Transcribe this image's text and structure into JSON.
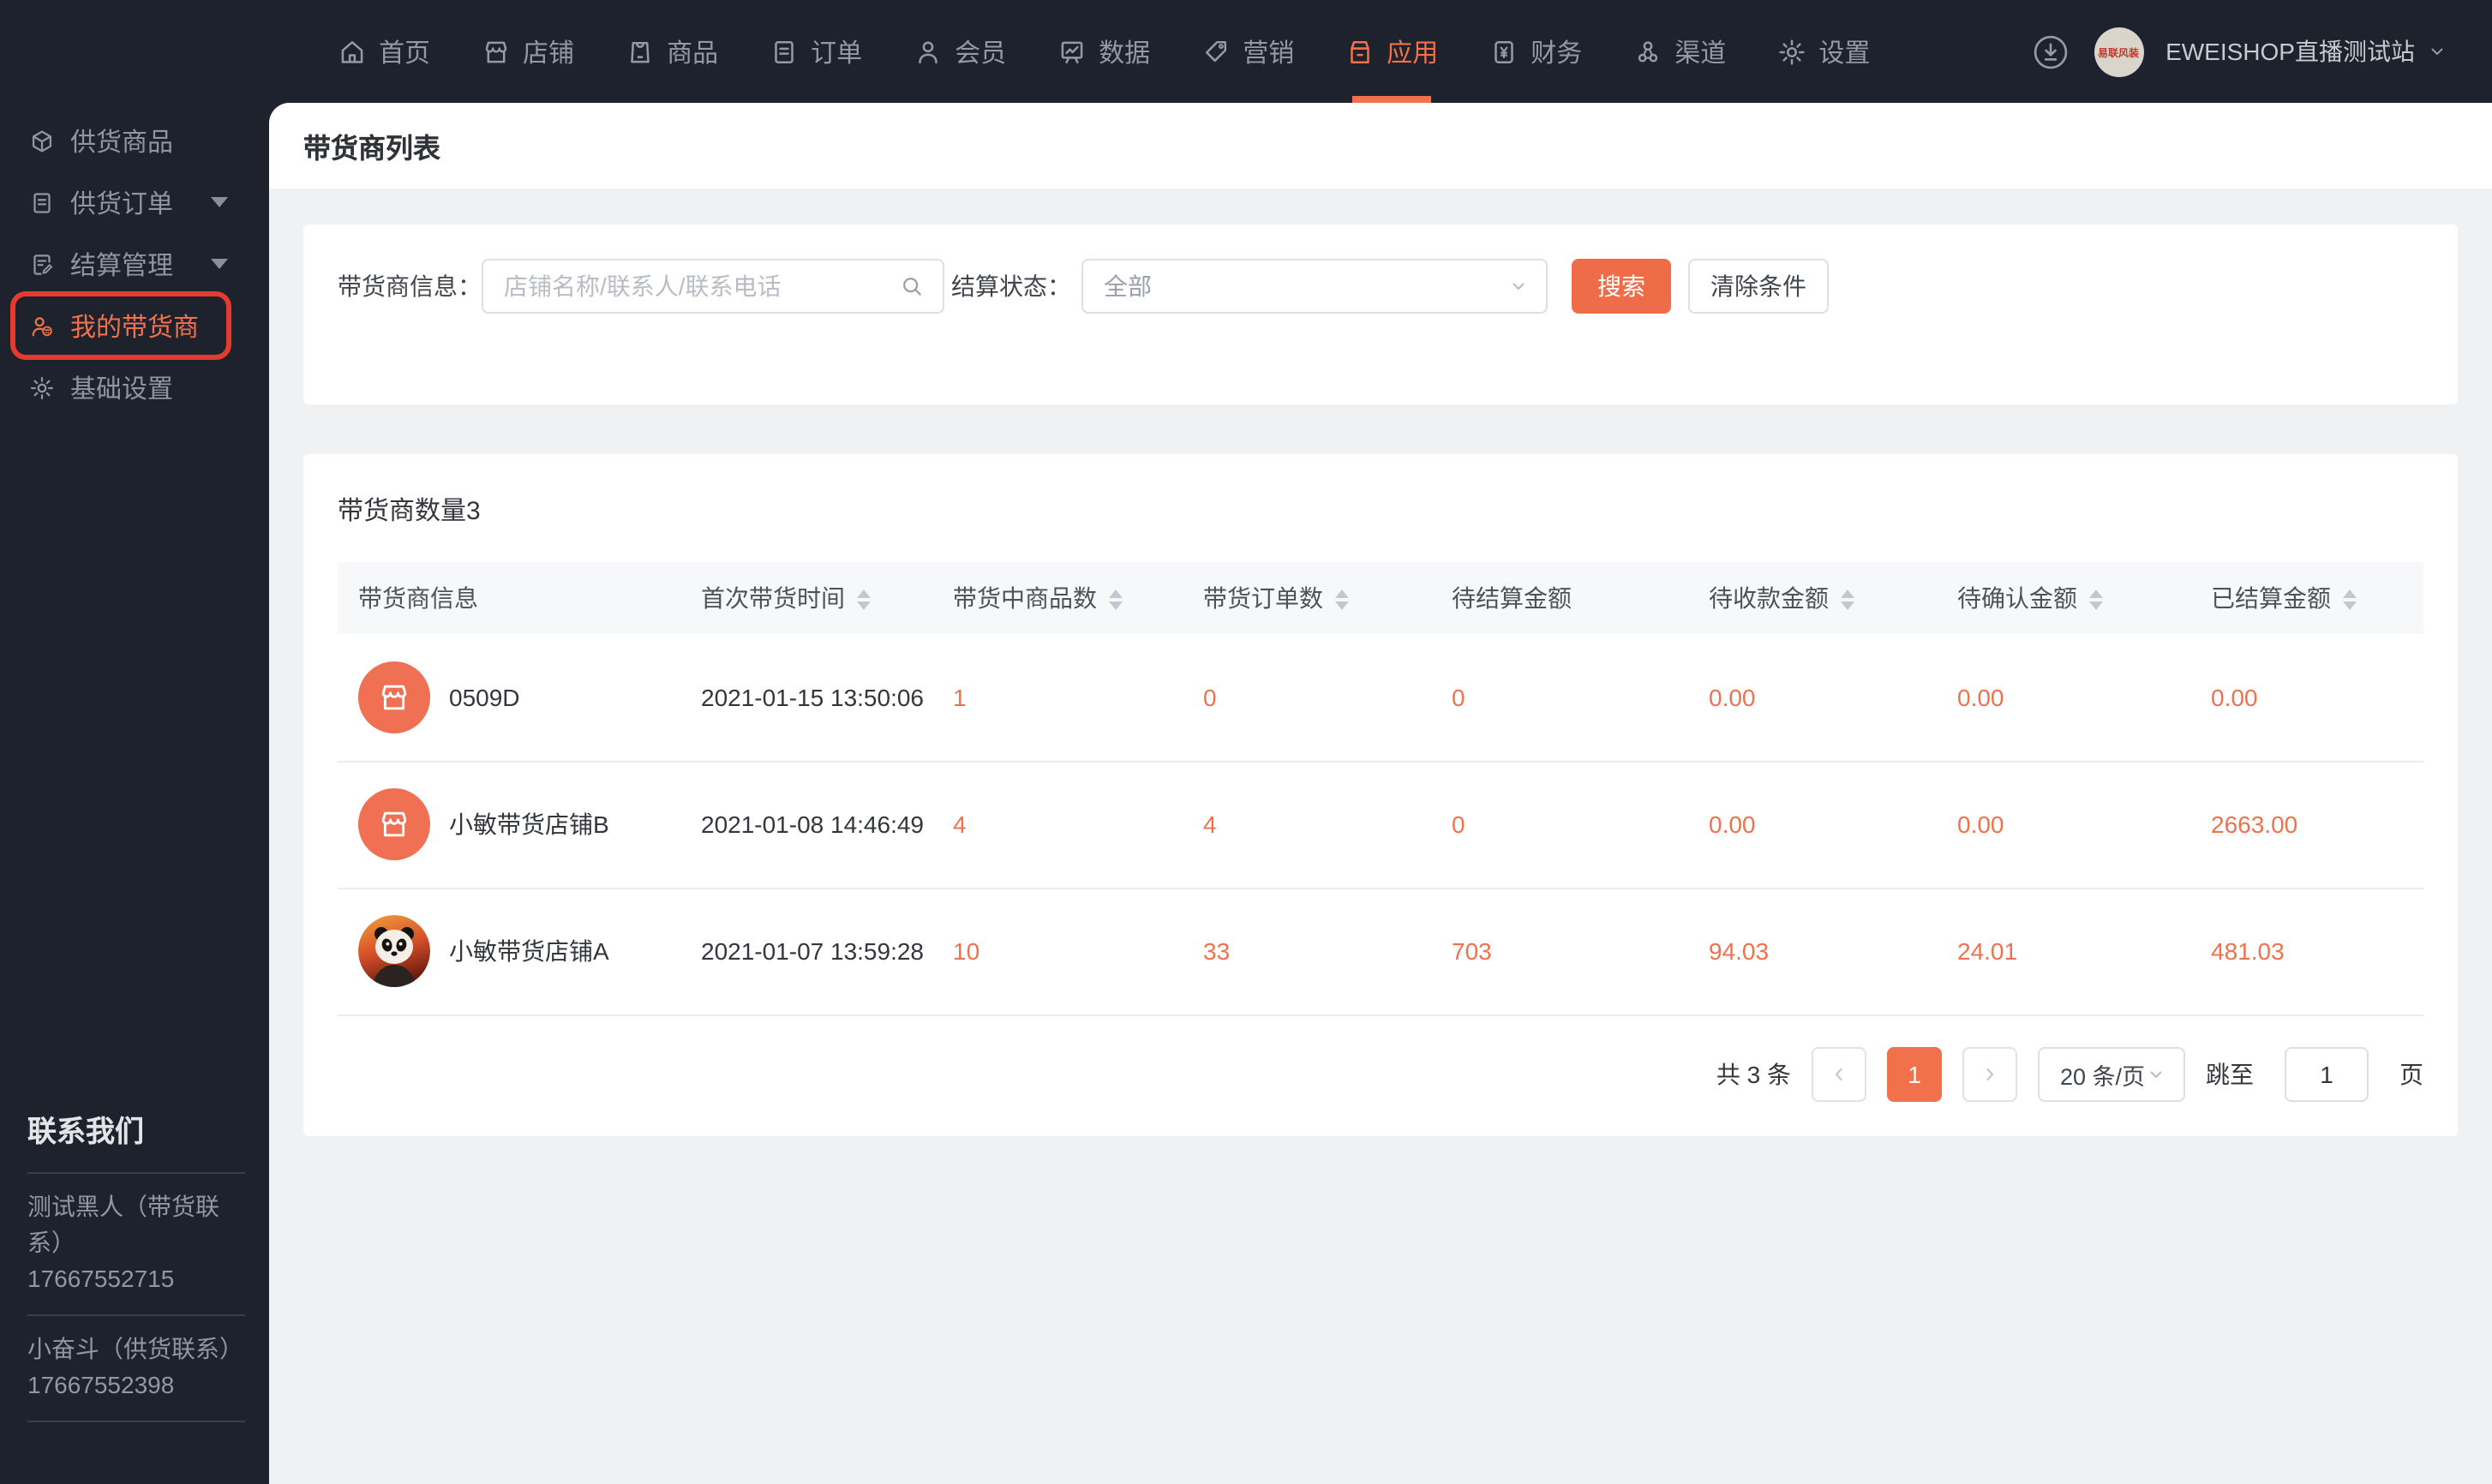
{
  "colors": {
    "accent": "#f0714c",
    "accent_button": "#ee6c47",
    "dark_bg": "#1e222c",
    "annotation_red": "#e53a2e",
    "page_bg": "#f0f1f2"
  },
  "nav": {
    "items": [
      {
        "label": "首页",
        "icon": "home-icon",
        "active": false
      },
      {
        "label": "店铺",
        "icon": "storefront-icon",
        "active": false
      },
      {
        "label": "商品",
        "icon": "goods-bag-icon",
        "active": false
      },
      {
        "label": "订单",
        "icon": "order-doc-icon",
        "active": false
      },
      {
        "label": "会员",
        "icon": "member-person-icon",
        "active": false
      },
      {
        "label": "数据",
        "icon": "data-chart-icon",
        "active": false
      },
      {
        "label": "营销",
        "icon": "marketing-tag-icon",
        "active": false
      },
      {
        "label": "应用",
        "icon": "apps-box-icon",
        "active": true
      },
      {
        "label": "财务",
        "icon": "finance-yuan-icon",
        "active": false
      },
      {
        "label": "渠道",
        "icon": "channel-share-icon",
        "active": false
      },
      {
        "label": "设置",
        "icon": "settings-gear-icon",
        "active": false
      }
    ],
    "account": {
      "store_name": "EWEISHOP直播测试站",
      "avatar_text": "易联风装"
    }
  },
  "sidebar": {
    "items": [
      {
        "label": "供货商品",
        "icon": "cube-icon",
        "expandable": false,
        "active": false
      },
      {
        "label": "供货订单",
        "icon": "doc-lines-icon",
        "expandable": true,
        "active": false
      },
      {
        "label": "结算管理",
        "icon": "settle-edit-icon",
        "expandable": true,
        "active": false
      },
      {
        "label": "我的带货商",
        "icon": "supplier-person-icon",
        "expandable": false,
        "active": true,
        "annotated": true
      },
      {
        "label": "基础设置",
        "icon": "gear-icon",
        "expandable": false,
        "active": false
      }
    ],
    "contact": {
      "title": "联系我们",
      "entries": [
        {
          "name": "测试黑人（带货联系）",
          "phone": "17667552715"
        },
        {
          "name": "小奋斗（供货联系）",
          "phone": "17667552398"
        }
      ]
    }
  },
  "page": {
    "title": "带货商列表",
    "filter": {
      "info_label": "带货商信息：",
      "info_placeholder": "店铺名称/联系人/联系电话",
      "status_label": "结算状态：",
      "status_value": "全部",
      "search_button": "搜索",
      "clear_button": "清除条件"
    },
    "table": {
      "count_label": "带货商数量3",
      "columns": [
        {
          "label": "带货商信息",
          "sortable": false
        },
        {
          "label": "首次带货时间",
          "sortable": true
        },
        {
          "label": "带货中商品数",
          "sortable": true
        },
        {
          "label": "带货订单数",
          "sortable": true
        },
        {
          "label": "待结算金额",
          "sortable": false
        },
        {
          "label": "待收款金额",
          "sortable": true
        },
        {
          "label": "待确认金额",
          "sortable": true
        },
        {
          "label": "已结算金额",
          "sortable": true
        }
      ],
      "rows": [
        {
          "name": "0509D",
          "avatar": "store-icon",
          "time": "2021-01-15 13:50:06",
          "values": [
            "1",
            "0",
            "0",
            "0.00",
            "0.00",
            "0.00"
          ]
        },
        {
          "name": "小敏带货店铺B",
          "avatar": "store-icon",
          "time": "2021-01-08 14:46:49",
          "values": [
            "4",
            "4",
            "0",
            "0.00",
            "0.00",
            "2663.00"
          ]
        },
        {
          "name": "小敏带货店铺A",
          "avatar": "panda-photo",
          "time": "2021-01-07 13:59:28",
          "values": [
            "10",
            "33",
            "703",
            "94.03",
            "24.01",
            "481.03"
          ]
        }
      ]
    },
    "pagination": {
      "total": "共 3 条",
      "current_page": "1",
      "page_size": "20 条/页",
      "jump_label": "跳至",
      "jump_value": "1",
      "page_unit": "页"
    }
  }
}
